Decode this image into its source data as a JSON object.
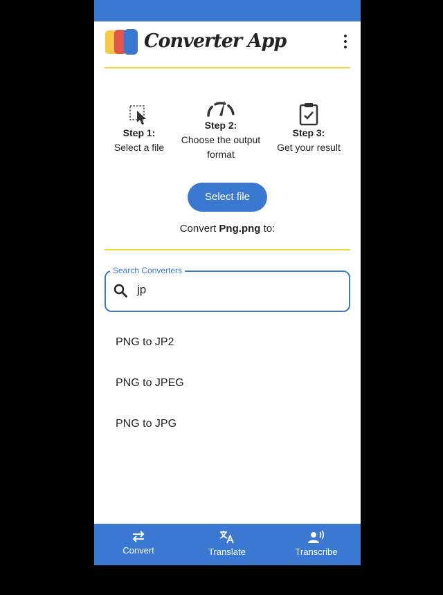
{
  "header": {
    "title": "Converter App"
  },
  "steps": [
    {
      "title": "Step 1:",
      "desc": "Select a file",
      "icon": "select-cursor-icon"
    },
    {
      "title": "Step 2:",
      "desc": "Choose the output format",
      "icon": "gauge-icon"
    },
    {
      "title": "Step 3:",
      "desc": "Get your result",
      "icon": "clipboard-check-icon"
    }
  ],
  "select_button": "Select file",
  "convert": {
    "prefix": "Convert",
    "filename": "Png.png",
    "suffix": "to:"
  },
  "search": {
    "label": "Search Converters",
    "value": "jp"
  },
  "results": [
    "PNG to JP2",
    "PNG to JPEG",
    "PNG to JPG"
  ],
  "nav": [
    {
      "label": "Convert",
      "icon": "swap-arrows-icon"
    },
    {
      "label": "Translate",
      "icon": "translate-icon"
    },
    {
      "label": "Transcribe",
      "icon": "voice-person-icon"
    }
  ],
  "colors": {
    "primary": "#3a78d1",
    "divider": "#f4d63a"
  }
}
